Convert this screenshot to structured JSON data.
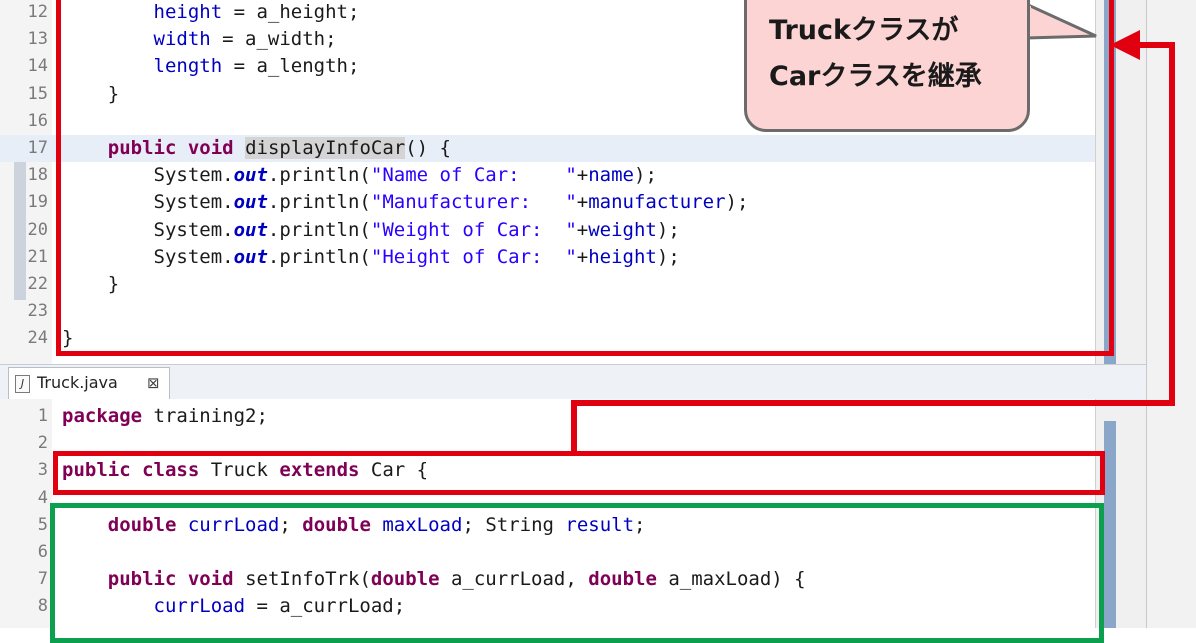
{
  "car_editor": {
    "lines": [
      {
        "num": "12",
        "tokens": [
          {
            "t": "        "
          },
          {
            "t": "height",
            "c": "fld"
          },
          {
            "t": " = a_height;"
          }
        ]
      },
      {
        "num": "13",
        "tokens": [
          {
            "t": "        "
          },
          {
            "t": "width",
            "c": "fld"
          },
          {
            "t": " = a_width;"
          }
        ]
      },
      {
        "num": "14",
        "tokens": [
          {
            "t": "        "
          },
          {
            "t": "length",
            "c": "fld"
          },
          {
            "t": " = a_length;"
          }
        ]
      },
      {
        "num": "15",
        "tokens": [
          {
            "t": "    }"
          }
        ]
      },
      {
        "num": "16",
        "tokens": []
      },
      {
        "num": "17",
        "highlight": true,
        "tokens": [
          {
            "t": "    "
          },
          {
            "t": "public",
            "c": "kw"
          },
          {
            "t": " "
          },
          {
            "t": "void",
            "c": "kw"
          },
          {
            "t": " "
          },
          {
            "t": "displayInfoCar",
            "c": "mdecl"
          },
          {
            "t": "() {"
          }
        ]
      },
      {
        "num": "18",
        "tokens": [
          {
            "t": "        System."
          },
          {
            "t": "out",
            "c": "sfld"
          },
          {
            "t": ".println("
          },
          {
            "t": "\"Name of Car:    \"",
            "c": "str"
          },
          {
            "t": "+"
          },
          {
            "t": "name",
            "c": "fld"
          },
          {
            "t": ");"
          }
        ]
      },
      {
        "num": "19",
        "tokens": [
          {
            "t": "        System."
          },
          {
            "t": "out",
            "c": "sfld"
          },
          {
            "t": ".println("
          },
          {
            "t": "\"Manufacturer:   \"",
            "c": "str"
          },
          {
            "t": "+"
          },
          {
            "t": "manufacturer",
            "c": "fld"
          },
          {
            "t": ");"
          }
        ]
      },
      {
        "num": "20",
        "tokens": [
          {
            "t": "        System."
          },
          {
            "t": "out",
            "c": "sfld"
          },
          {
            "t": ".println("
          },
          {
            "t": "\"Weight of Car:  \"",
            "c": "str"
          },
          {
            "t": "+"
          },
          {
            "t": "weight",
            "c": "fld"
          },
          {
            "t": ");"
          }
        ]
      },
      {
        "num": "21",
        "tokens": [
          {
            "t": "        System."
          },
          {
            "t": "out",
            "c": "sfld"
          },
          {
            "t": ".println("
          },
          {
            "t": "\"Height of Car:  \"",
            "c": "str"
          },
          {
            "t": "+"
          },
          {
            "t": "height",
            "c": "fld"
          },
          {
            "t": ");"
          }
        ]
      },
      {
        "num": "22",
        "tokens": [
          {
            "t": "    }"
          }
        ]
      },
      {
        "num": "23",
        "tokens": []
      },
      {
        "num": "24",
        "tokens": [
          {
            "t": "}"
          }
        ]
      }
    ]
  },
  "truck_tab": {
    "label": "Truck.java",
    "close_glyph": "⊠",
    "icon_glyph": "J"
  },
  "truck_editor": {
    "lines": [
      {
        "num": "1",
        "tokens": [
          {
            "t": "package",
            "c": "kw"
          },
          {
            "t": " training2;"
          }
        ]
      },
      {
        "num": "2",
        "tokens": []
      },
      {
        "num": "3",
        "tokens": [
          {
            "t": "public",
            "c": "kw"
          },
          {
            "t": " "
          },
          {
            "t": "class",
            "c": "kw"
          },
          {
            "t": " Truck "
          },
          {
            "t": "extends",
            "c": "kw"
          },
          {
            "t": " Car {"
          }
        ]
      },
      {
        "num": "4",
        "tokens": []
      },
      {
        "num": "5",
        "tokens": [
          {
            "t": "    "
          },
          {
            "t": "double",
            "c": "kw"
          },
          {
            "t": " "
          },
          {
            "t": "currLoad",
            "c": "fld"
          },
          {
            "t": "; "
          },
          {
            "t": "double",
            "c": "kw"
          },
          {
            "t": " "
          },
          {
            "t": "maxLoad",
            "c": "fld"
          },
          {
            "t": "; String "
          },
          {
            "t": "result",
            "c": "fld"
          },
          {
            "t": ";"
          }
        ]
      },
      {
        "num": "6",
        "tokens": []
      },
      {
        "num": "7",
        "tokens": [
          {
            "t": "    "
          },
          {
            "t": "public",
            "c": "kw"
          },
          {
            "t": " "
          },
          {
            "t": "void",
            "c": "kw"
          },
          {
            "t": " setInfoTrk("
          },
          {
            "t": "double",
            "c": "kw"
          },
          {
            "t": " a_currLoad, "
          },
          {
            "t": "double",
            "c": "kw"
          },
          {
            "t": " a_maxLoad) {"
          }
        ]
      },
      {
        "num": "8",
        "tokens": [
          {
            "t": "        "
          },
          {
            "t": "currLoad",
            "c": "fld"
          },
          {
            "t": " = a_currLoad;"
          }
        ]
      }
    ]
  },
  "callout": {
    "line1": "Truckクラスが",
    "line2": "Carクラスを継承"
  },
  "colors": {
    "highlight_red": "#e00010",
    "highlight_green": "#0ca04e",
    "callout_fill": "#fcd4d4"
  }
}
